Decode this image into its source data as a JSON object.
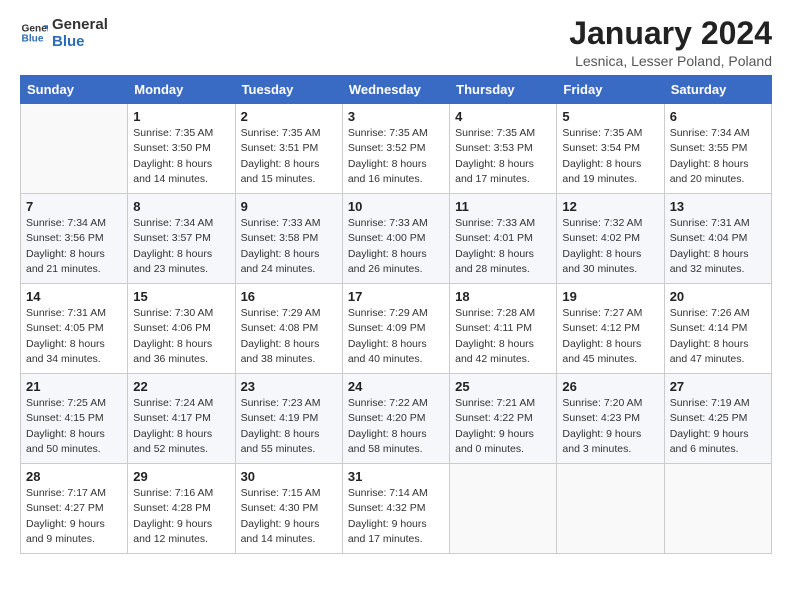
{
  "logo": {
    "text_general": "General",
    "text_blue": "Blue"
  },
  "title": "January 2024",
  "location": "Lesnica, Lesser Poland, Poland",
  "days_of_week": [
    "Sunday",
    "Monday",
    "Tuesday",
    "Wednesday",
    "Thursday",
    "Friday",
    "Saturday"
  ],
  "weeks": [
    [
      {
        "day": null,
        "info": ""
      },
      {
        "day": "1",
        "info": "Sunrise: 7:35 AM\nSunset: 3:50 PM\nDaylight: 8 hours\nand 14 minutes."
      },
      {
        "day": "2",
        "info": "Sunrise: 7:35 AM\nSunset: 3:51 PM\nDaylight: 8 hours\nand 15 minutes."
      },
      {
        "day": "3",
        "info": "Sunrise: 7:35 AM\nSunset: 3:52 PM\nDaylight: 8 hours\nand 16 minutes."
      },
      {
        "day": "4",
        "info": "Sunrise: 7:35 AM\nSunset: 3:53 PM\nDaylight: 8 hours\nand 17 minutes."
      },
      {
        "day": "5",
        "info": "Sunrise: 7:35 AM\nSunset: 3:54 PM\nDaylight: 8 hours\nand 19 minutes."
      },
      {
        "day": "6",
        "info": "Sunrise: 7:34 AM\nSunset: 3:55 PM\nDaylight: 8 hours\nand 20 minutes."
      }
    ],
    [
      {
        "day": "7",
        "info": "Sunrise: 7:34 AM\nSunset: 3:56 PM\nDaylight: 8 hours\nand 21 minutes."
      },
      {
        "day": "8",
        "info": "Sunrise: 7:34 AM\nSunset: 3:57 PM\nDaylight: 8 hours\nand 23 minutes."
      },
      {
        "day": "9",
        "info": "Sunrise: 7:33 AM\nSunset: 3:58 PM\nDaylight: 8 hours\nand 24 minutes."
      },
      {
        "day": "10",
        "info": "Sunrise: 7:33 AM\nSunset: 4:00 PM\nDaylight: 8 hours\nand 26 minutes."
      },
      {
        "day": "11",
        "info": "Sunrise: 7:33 AM\nSunset: 4:01 PM\nDaylight: 8 hours\nand 28 minutes."
      },
      {
        "day": "12",
        "info": "Sunrise: 7:32 AM\nSunset: 4:02 PM\nDaylight: 8 hours\nand 30 minutes."
      },
      {
        "day": "13",
        "info": "Sunrise: 7:31 AM\nSunset: 4:04 PM\nDaylight: 8 hours\nand 32 minutes."
      }
    ],
    [
      {
        "day": "14",
        "info": "Sunrise: 7:31 AM\nSunset: 4:05 PM\nDaylight: 8 hours\nand 34 minutes."
      },
      {
        "day": "15",
        "info": "Sunrise: 7:30 AM\nSunset: 4:06 PM\nDaylight: 8 hours\nand 36 minutes."
      },
      {
        "day": "16",
        "info": "Sunrise: 7:29 AM\nSunset: 4:08 PM\nDaylight: 8 hours\nand 38 minutes."
      },
      {
        "day": "17",
        "info": "Sunrise: 7:29 AM\nSunset: 4:09 PM\nDaylight: 8 hours\nand 40 minutes."
      },
      {
        "day": "18",
        "info": "Sunrise: 7:28 AM\nSunset: 4:11 PM\nDaylight: 8 hours\nand 42 minutes."
      },
      {
        "day": "19",
        "info": "Sunrise: 7:27 AM\nSunset: 4:12 PM\nDaylight: 8 hours\nand 45 minutes."
      },
      {
        "day": "20",
        "info": "Sunrise: 7:26 AM\nSunset: 4:14 PM\nDaylight: 8 hours\nand 47 minutes."
      }
    ],
    [
      {
        "day": "21",
        "info": "Sunrise: 7:25 AM\nSunset: 4:15 PM\nDaylight: 8 hours\nand 50 minutes."
      },
      {
        "day": "22",
        "info": "Sunrise: 7:24 AM\nSunset: 4:17 PM\nDaylight: 8 hours\nand 52 minutes."
      },
      {
        "day": "23",
        "info": "Sunrise: 7:23 AM\nSunset: 4:19 PM\nDaylight: 8 hours\nand 55 minutes."
      },
      {
        "day": "24",
        "info": "Sunrise: 7:22 AM\nSunset: 4:20 PM\nDaylight: 8 hours\nand 58 minutes."
      },
      {
        "day": "25",
        "info": "Sunrise: 7:21 AM\nSunset: 4:22 PM\nDaylight: 9 hours\nand 0 minutes."
      },
      {
        "day": "26",
        "info": "Sunrise: 7:20 AM\nSunset: 4:23 PM\nDaylight: 9 hours\nand 3 minutes."
      },
      {
        "day": "27",
        "info": "Sunrise: 7:19 AM\nSunset: 4:25 PM\nDaylight: 9 hours\nand 6 minutes."
      }
    ],
    [
      {
        "day": "28",
        "info": "Sunrise: 7:17 AM\nSunset: 4:27 PM\nDaylight: 9 hours\nand 9 minutes."
      },
      {
        "day": "29",
        "info": "Sunrise: 7:16 AM\nSunset: 4:28 PM\nDaylight: 9 hours\nand 12 minutes."
      },
      {
        "day": "30",
        "info": "Sunrise: 7:15 AM\nSunset: 4:30 PM\nDaylight: 9 hours\nand 14 minutes."
      },
      {
        "day": "31",
        "info": "Sunrise: 7:14 AM\nSunset: 4:32 PM\nDaylight: 9 hours\nand 17 minutes."
      },
      {
        "day": null,
        "info": ""
      },
      {
        "day": null,
        "info": ""
      },
      {
        "day": null,
        "info": ""
      }
    ]
  ]
}
